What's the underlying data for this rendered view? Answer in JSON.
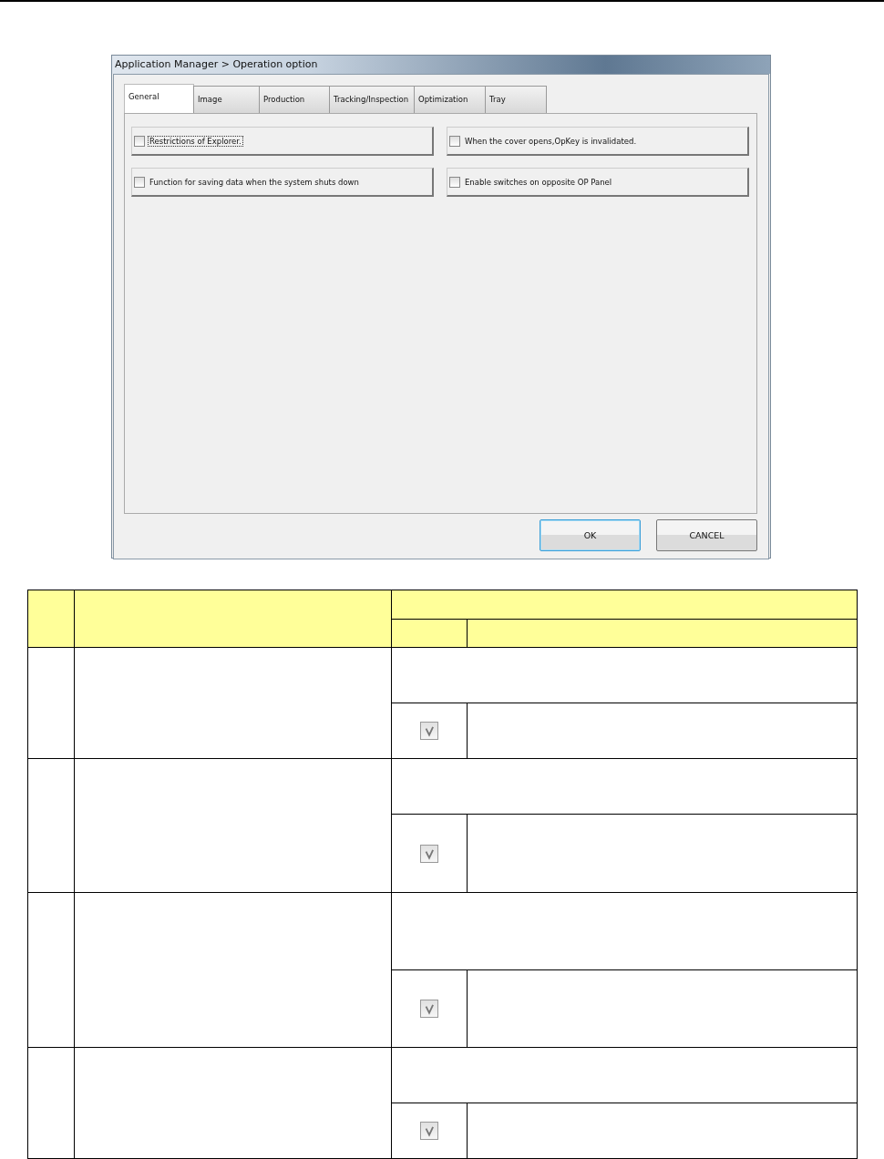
{
  "window": {
    "title": "Application Manager > Operation option"
  },
  "tabs": [
    {
      "label": "General",
      "selected": true
    },
    {
      "label": "Image",
      "selected": false
    },
    {
      "label": "Production",
      "selected": false
    },
    {
      "label": "Tracking/Inspection",
      "selected": false
    },
    {
      "label": "Optimization",
      "selected": false
    },
    {
      "label": "Tray",
      "selected": false
    }
  ],
  "options": [
    {
      "label": "Restrictions of Explorer.",
      "checked": false,
      "focused": true
    },
    {
      "label": "When the cover opens,OpKey is invalidated.",
      "checked": false,
      "focused": false
    },
    {
      "label": "Function for saving data when the system shuts down",
      "checked": false,
      "focused": false
    },
    {
      "label": "Enable switches on opposite OP Panel",
      "checked": false,
      "focused": false
    }
  ],
  "buttons": [
    {
      "label": "OK",
      "kind": "default"
    },
    {
      "label": "CANCEL",
      "kind": "normal"
    }
  ],
  "spec_table": {
    "rows": [
      {
        "checked": true
      },
      {
        "checked": true
      },
      {
        "checked": true
      },
      {
        "checked": true
      }
    ]
  }
}
